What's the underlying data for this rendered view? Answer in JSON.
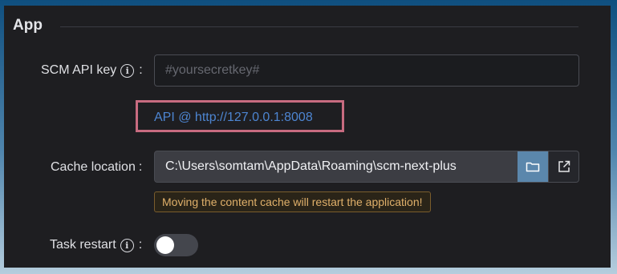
{
  "section": {
    "title": "App"
  },
  "api_key": {
    "label": "SCM API key",
    "colon": ":",
    "info_glyph": "i",
    "value": "",
    "placeholder": "#yoursecretkey#",
    "link_text": "API @ http://127.0.0.1:8008"
  },
  "cache": {
    "label": "Cache location",
    "colon": ":",
    "value": "C:\\Users\\somtam\\AppData\\Roaming\\scm-next-plus",
    "folder_icon": "folder-icon",
    "open_icon": "external-link-icon",
    "warning": "Moving the content cache will restart the application!"
  },
  "task_restart": {
    "label": "Task restart",
    "colon": ":",
    "info_glyph": "i",
    "enabled": false
  },
  "colors": {
    "accent": "#5b87ac",
    "link": "#4d85d1",
    "warning_text": "#e0b06a",
    "highlight": "#c86b80"
  }
}
